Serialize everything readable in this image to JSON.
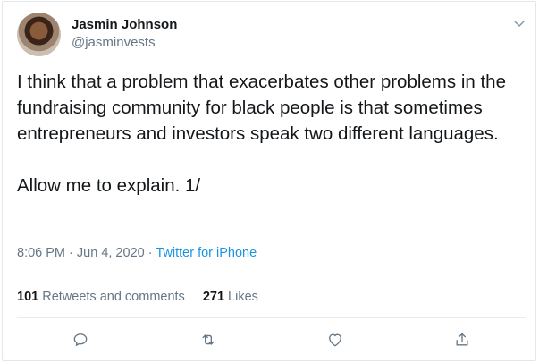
{
  "user": {
    "display_name": "Jasmin Johnson",
    "handle": "@jasminvests"
  },
  "tweet": {
    "text": "I think that a problem that exacerbates other problems in the fundraising community for black people is that sometimes entrepreneurs and investors speak two different languages.\n\nAllow me to explain. 1/",
    "time": "8:06 PM",
    "separator": "·",
    "date": "Jun 4, 2020",
    "source": "Twitter for iPhone"
  },
  "stats": {
    "retweets_count": "101",
    "retweets_label": "Retweets and comments",
    "likes_count": "271",
    "likes_label": "Likes"
  },
  "icons": {
    "menu": "chevron-down-icon",
    "reply": "reply-icon",
    "retweet": "retweet-icon",
    "like": "heart-icon",
    "share": "share-icon"
  },
  "colors": {
    "text": "#14171a",
    "secondary": "#657786",
    "link": "#1b95e0",
    "border": "#e1e8ed"
  }
}
